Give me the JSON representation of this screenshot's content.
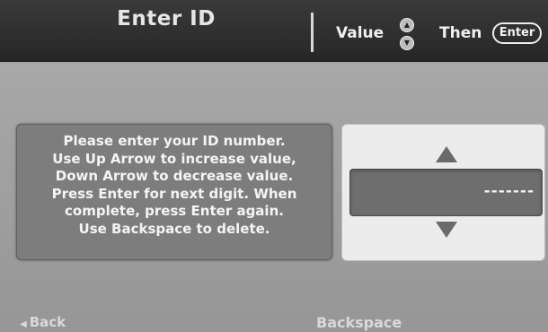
{
  "header": {
    "title": "Enter ID",
    "value_label": "Value",
    "then_label": "Then",
    "enter_label": "Enter",
    "up_icon": "up-arrow-icon",
    "down_icon": "down-arrow-icon"
  },
  "instructions": {
    "lines": [
      "Please enter your ID number.",
      "Use Up Arrow to increase value,",
      "Down Arrow to decrease value.",
      "Press Enter for next digit.  When",
      "complete, press Enter again.",
      "Use Backspace to delete."
    ]
  },
  "entry": {
    "value": "-------"
  },
  "footer": {
    "back_label": "Back",
    "backspace_label": "Backspace"
  }
}
